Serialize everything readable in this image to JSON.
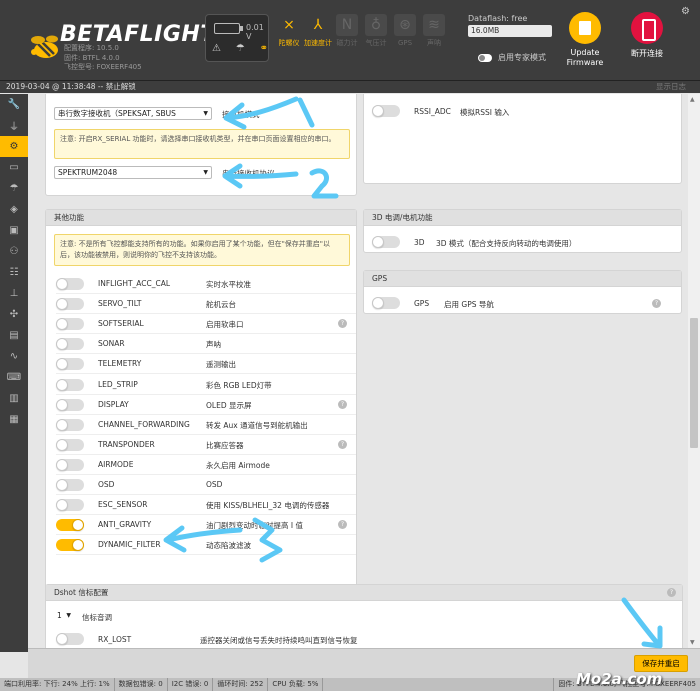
{
  "header": {
    "logo_text": "BETAFLIGHT",
    "configurator_version": "配置程序: 10.5.0",
    "firmware": "固件: BTFL 4.0.0",
    "flight_controller": "飞控型号: FOXEERF405",
    "voltage": "0.01 V",
    "sensors": [
      {
        "label": "陀螺仪",
        "icon": "gyro-icon",
        "state": "on"
      },
      {
        "label": "加速度计",
        "icon": "accel-icon",
        "state": "on"
      },
      {
        "label": "磁力计",
        "icon": "mag-icon",
        "state": "off"
      },
      {
        "label": "气压计",
        "icon": "baro-icon",
        "state": "off"
      },
      {
        "label": "GPS",
        "icon": "gps-icon",
        "state": "off"
      },
      {
        "label": "声呐",
        "icon": "sonar-icon",
        "state": "off"
      }
    ],
    "dataflash_label": "Dataflash: free",
    "dataflash_value": "16.0MB",
    "expert_mode": "启用专家模式",
    "update_firmware": "Update Firmware",
    "disconnect": "断开连接"
  },
  "log": {
    "message": "2019-03-04 @ 11:38:48 -- 禁止解锁",
    "show_log": "显示日志"
  },
  "receiver_panel": {
    "receiver_mode": "串行数字接收机（SPEKSAT, SBUS",
    "receiver_mode_label": "接收机模式",
    "note": "注意: 开启RX_SERIAL 功能时，请选择串口接收机类型，并在串口页面设置相应的串口。",
    "provider": "SPEKTRUM2048",
    "provider_label": "串行接收机协议"
  },
  "rssi_panel": {
    "name": "RSSI_ADC",
    "desc": "模拟RSSI 输入"
  },
  "other_features": {
    "title": "其他功能",
    "note": "注意: 不是所有飞控都能支持所有的功能。如果你启用了某个功能，但在\"保存并重启\"以后，该功能被禁用，则说明你的飞控不支持该功能。",
    "features": [
      {
        "name": "INFLIGHT_ACC_CAL",
        "desc": "实时水平校准",
        "on": false,
        "help": false
      },
      {
        "name": "SERVO_TILT",
        "desc": "舵机云台",
        "on": false,
        "help": false
      },
      {
        "name": "SOFTSERIAL",
        "desc": "启用软串口",
        "on": false,
        "help": true
      },
      {
        "name": "SONAR",
        "desc": "声呐",
        "on": false,
        "help": false
      },
      {
        "name": "TELEMETRY",
        "desc": "遥测输出",
        "on": false,
        "help": false
      },
      {
        "name": "LED_STRIP",
        "desc": "彩色 RGB LED灯带",
        "on": false,
        "help": false
      },
      {
        "name": "DISPLAY",
        "desc": "OLED 显示屏",
        "on": false,
        "help": true
      },
      {
        "name": "CHANNEL_FORWARDING",
        "desc": "转发 Aux 通道信号到舵机输出",
        "on": false,
        "help": false
      },
      {
        "name": "TRANSPONDER",
        "desc": "比赛应答器",
        "on": false,
        "help": true
      },
      {
        "name": "AIRMODE",
        "desc": "永久启用 Airmode",
        "on": false,
        "help": false
      },
      {
        "name": "OSD",
        "desc": "OSD",
        "on": false,
        "help": false
      },
      {
        "name": "ESC_SENSOR",
        "desc": "使用 KISS/BLHELI_32 电调的传感器",
        "on": false,
        "help": false
      },
      {
        "name": "ANTI_GRAVITY",
        "desc": "油门剧烈变动时临时提高 I 值",
        "on": true,
        "help": true
      },
      {
        "name": "DYNAMIC_FILTER",
        "desc": "动态陷波滤波",
        "on": true,
        "help": false
      }
    ]
  },
  "esc_panel": {
    "title": "3D 电调/电机功能",
    "name": "3D",
    "desc": "3D 模式（配合支持反向转动的电调使用）"
  },
  "gps_panel": {
    "title": "GPS",
    "name": "GPS",
    "desc": "启用 GPS 导航"
  },
  "dshot_panel": {
    "title": "Dshot 信标配置",
    "tone": "1",
    "tone_label": "信标音调",
    "rx_lost_name": "RX_LOST",
    "rx_lost_desc": "遥控器关闭或信号丢失时持续鸣叫直到信号恢复"
  },
  "save_button": "保存并重启",
  "statusbar": {
    "port_usage": "端口利用率: 下行: 24% 上行: 1%",
    "packet_error": "数据包错误: 0",
    "i2c_error": "I2C 错误: 0",
    "cycle_time": "循环时间: 252",
    "cpu_load": "CPU 负载: 5%",
    "firmware": "固件: BTFL 4.0.0, 飞控型号: FOXEERF405"
  },
  "watermark": "Mo2a.com",
  "colors": {
    "accent": "#ffbb00",
    "disconnect": "#e2123f",
    "annotation": "#5bc8f5"
  }
}
